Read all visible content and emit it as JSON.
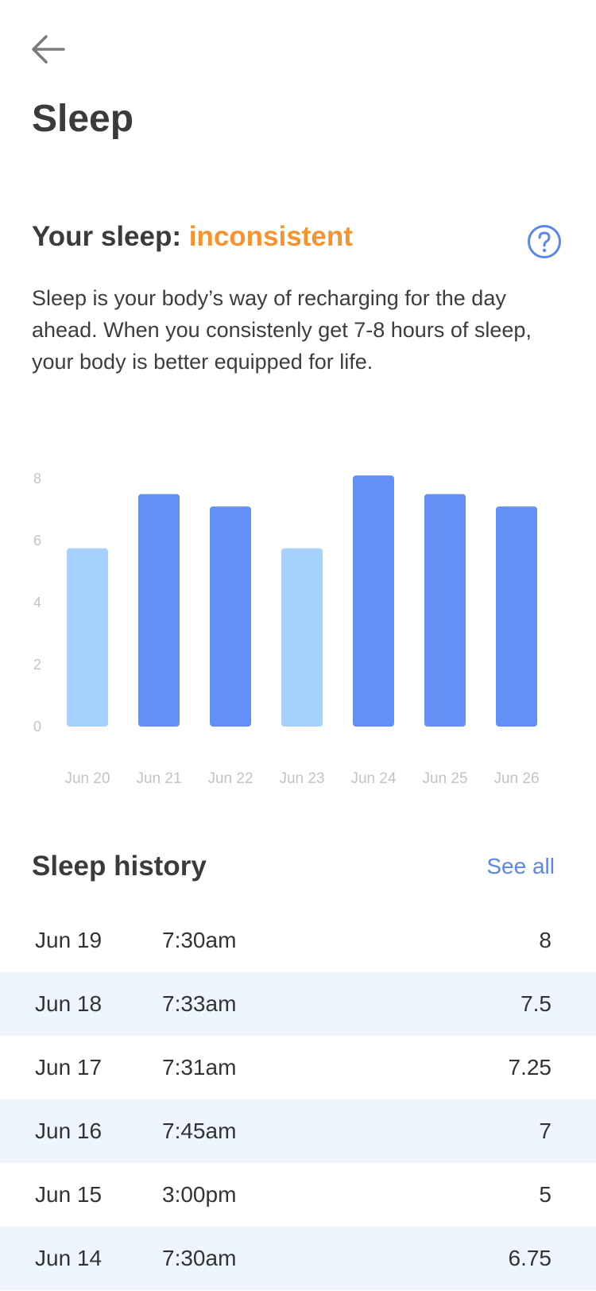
{
  "page": {
    "title": "Sleep"
  },
  "summary": {
    "prefix": "Your sleep: ",
    "status": "inconsistent",
    "description": "Sleep is your body’s way of recharging for the day ahead. When you consistenly get 7-8 hours of sleep, your body is better equipped for life."
  },
  "chart_data": {
    "type": "bar",
    "categories": [
      "Jun 20",
      "Jun 21",
      "Jun 22",
      "Jun 23",
      "Jun 24",
      "Jun 25",
      "Jun 26"
    ],
    "values": [
      5.75,
      7.5,
      7.1,
      5.75,
      8.1,
      7.5,
      7.1
    ],
    "ylim": [
      0,
      8
    ],
    "yticks": [
      "0",
      "2",
      "4",
      "6",
      "8"
    ],
    "grid": false,
    "title": "",
    "xlabel": "",
    "ylabel": "",
    "colors": {
      "in_range": "#6290f6",
      "below_range": "#a6d0fd"
    },
    "highlight_threshold": 7
  },
  "history": {
    "title": "Sleep history",
    "see_all": "See all",
    "rows": [
      {
        "date": "Jun 19",
        "time": "7:30am",
        "hours": "8"
      },
      {
        "date": "Jun 18",
        "time": "7:33am",
        "hours": "7.5"
      },
      {
        "date": "Jun 17",
        "time": "7:31am",
        "hours": "7.25"
      },
      {
        "date": "Jun 16",
        "time": "7:45am",
        "hours": "7"
      },
      {
        "date": "Jun 15",
        "time": "3:00pm",
        "hours": "5"
      },
      {
        "date": "Jun 14",
        "time": "7:30am",
        "hours": "6.75"
      }
    ]
  },
  "icons": {
    "back": "arrow-left-icon",
    "help": "question-circle-icon"
  },
  "colors": {
    "status": "#f7932f",
    "accent": "#5b87ec",
    "row_stripe": "#eef5ff",
    "axis_text": "#c3c3c3"
  }
}
